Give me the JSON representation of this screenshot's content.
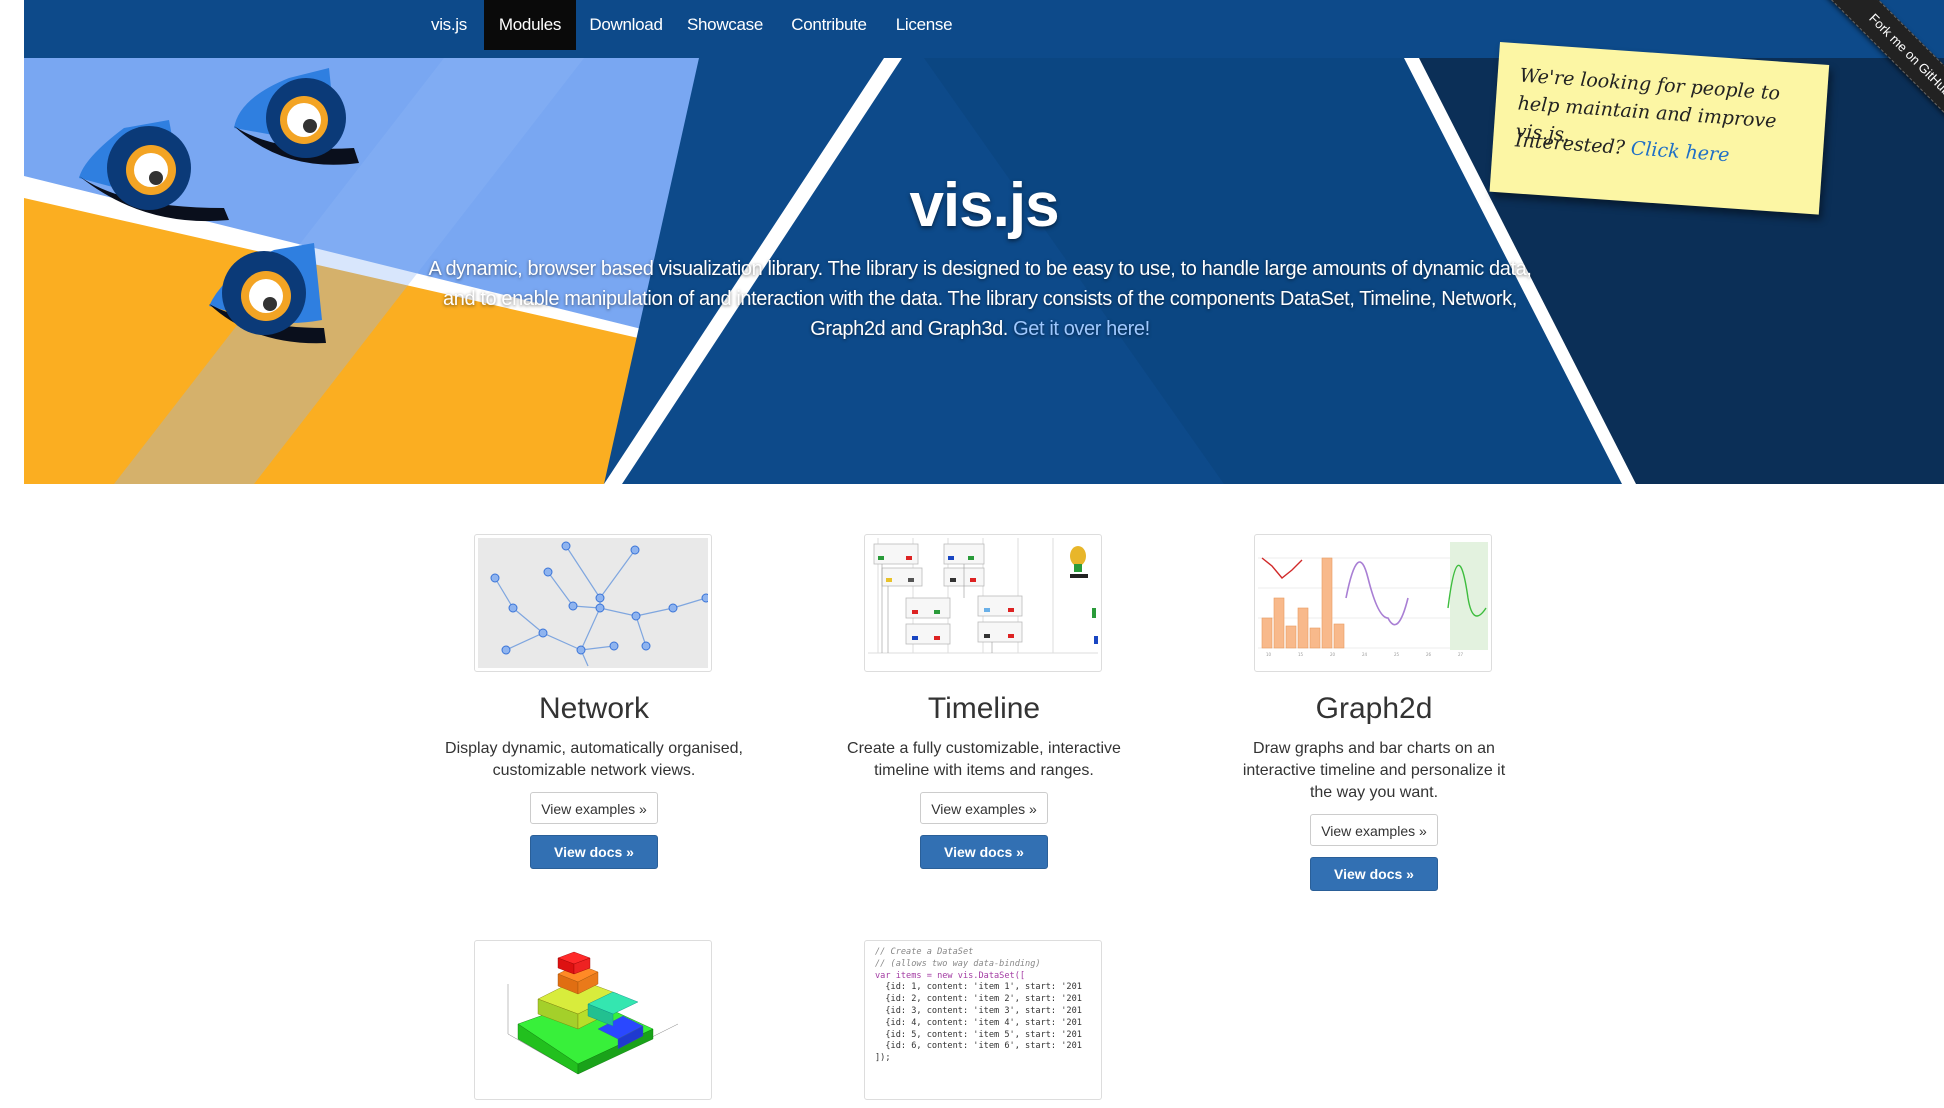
{
  "nav": {
    "items": [
      "vis.js",
      "Modules",
      "Download",
      "Showcase",
      "Contribute",
      "License"
    ],
    "active": "Modules"
  },
  "hero": {
    "title": "vis.js",
    "description": "A dynamic, browser based visualization library. The library is designed to be easy to use, to handle large amounts of dynamic data, and to enable manipulation of and interaction with the data. The library consists of the components DataSet, Timeline, Network, Graph2d and Graph3d.",
    "link_text": "Get it over here!"
  },
  "sticky_note": {
    "line1": "We're looking for people to help maintain and improve vis.js.",
    "prefix": "Interested?",
    "link_text": "Click here"
  },
  "ribbon": {
    "text": "Fork me on GitHub"
  },
  "modules": [
    {
      "title": "Network",
      "description": "Display dynamic, automatically organised, customizable network views.",
      "examples_label": "View examples »",
      "docs_label": "View docs »"
    },
    {
      "title": "Timeline",
      "description": "Create a fully customizable, interactive timeline with items and ranges.",
      "examples_label": "View examples »",
      "docs_label": "View docs »"
    },
    {
      "title": "Graph2d",
      "description": "Draw graphs and bar charts on an interactive timeline and personalize it the way you want.",
      "examples_label": "View examples »",
      "docs_label": "View docs »"
    }
  ],
  "code_sample": {
    "lines": [
      "// Create a DataSet",
      "// (allows two way data-binding)",
      "var items = new vis.DataSet([",
      "  {id: 1, content: 'item 1', start: '201",
      "  {id: 2, content: 'item 2', start: '201",
      "  {id: 3, content: 'item 3', start: '201",
      "  {id: 4, content: 'item 4', start: '201",
      "  {id: 5, content: 'item 5', start: '201",
      "  {id: 6, content: 'item 6', start: '201",
      "]);"
    ]
  },
  "colors": {
    "navbar": "#0d4a8a",
    "hero_light_blue": "#79a7f2",
    "hero_orange": "#fbae21",
    "hero_dark_blue": "#0d4a8a",
    "hero_navy": "#0b2f57",
    "primary_button": "#3270b3"
  }
}
